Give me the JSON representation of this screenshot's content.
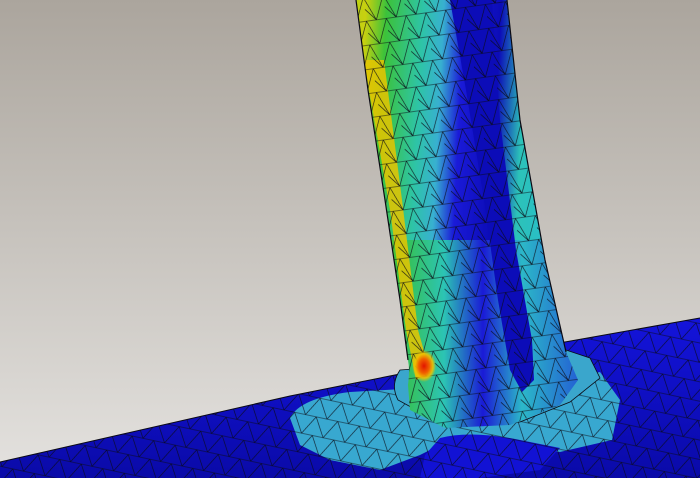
{
  "scene": {
    "subject": "fea-stress-contour-t-joint",
    "colors": {
      "background_top": "#aba59d",
      "background_bottom": "#e4e2df",
      "mesh_line": "#0a0a14",
      "contour_blue": "#1010d8",
      "contour_dark_blue": "#0c0cb8",
      "contour_light_blue": "#36a6d0",
      "contour_cyan": "#2ec4b0",
      "contour_green": "#28c23c",
      "contour_yellow_green": "#a8d418",
      "contour_yellow": "#e8d000",
      "contour_orange": "#f08a00",
      "contour_red": "#e21400"
    }
  }
}
